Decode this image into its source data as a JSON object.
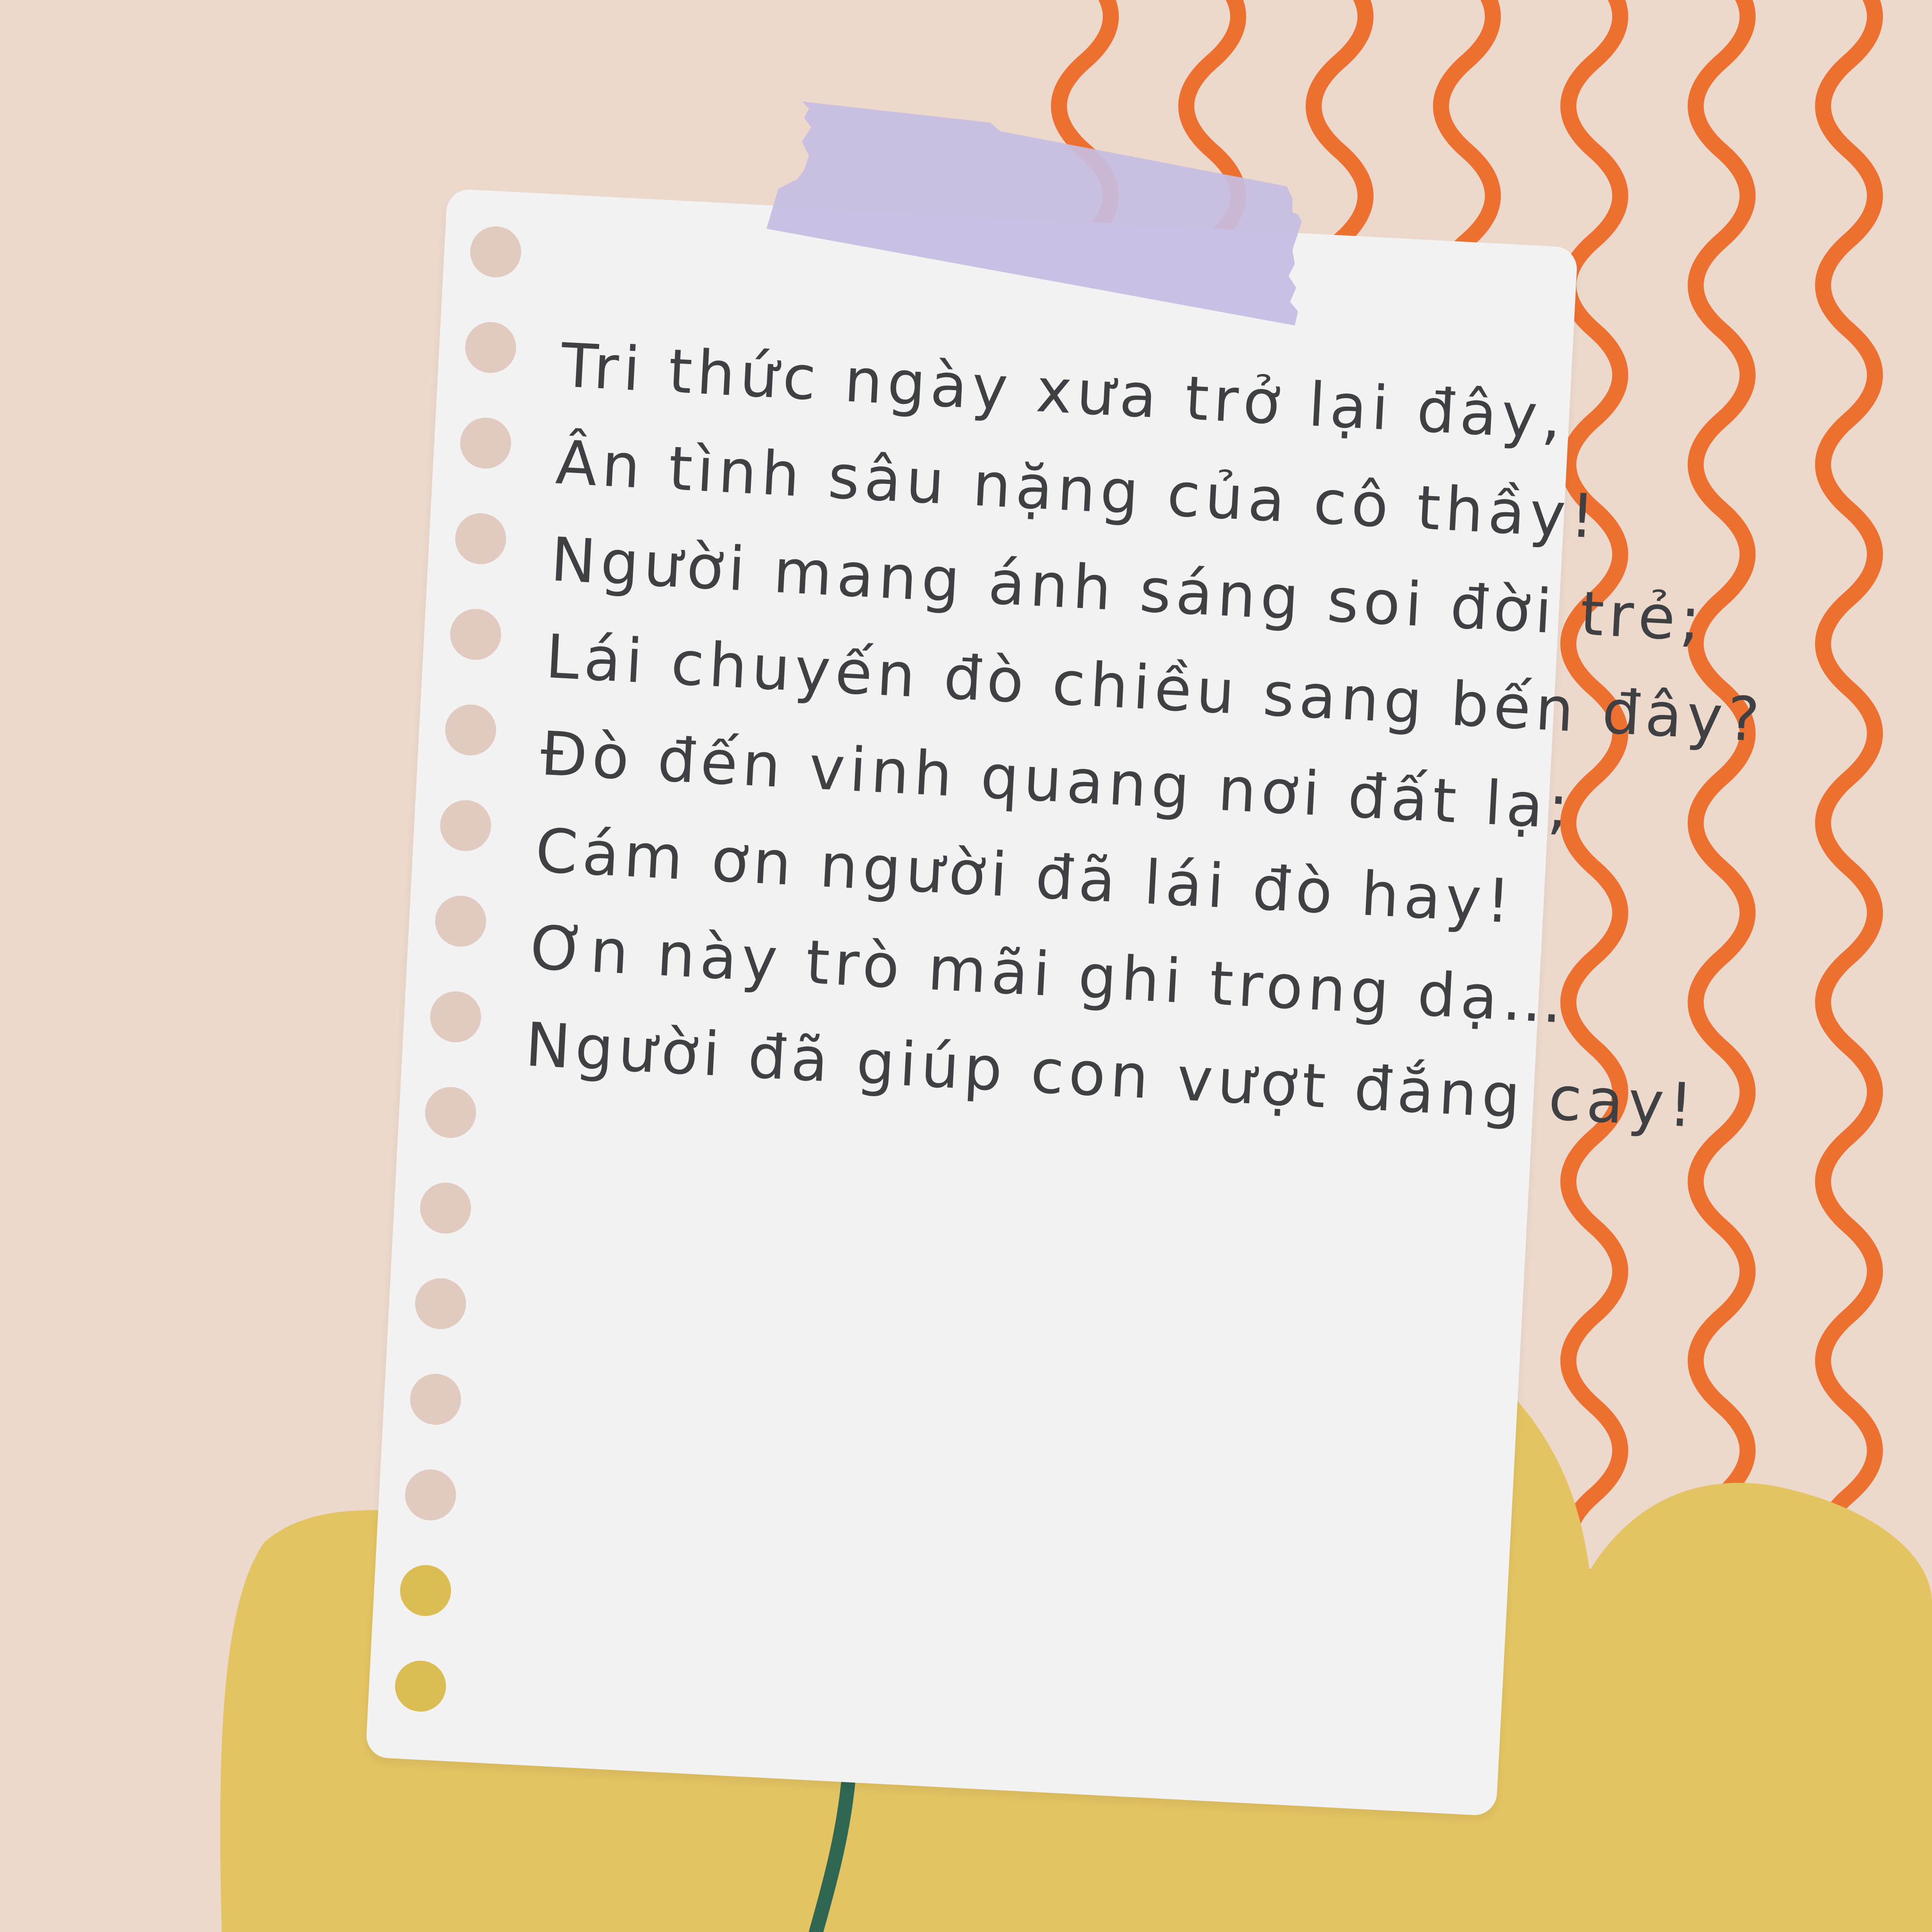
{
  "colors": {
    "background": "#ecd9cb",
    "stripes": "#ee7031",
    "yellow_blob": "#e3c362",
    "stem": "#2f6753",
    "paper": "#f2f2f2",
    "tape": "#c5bde2",
    "hole_pink": "#e1cbc0",
    "hole_yellow": "#dcbd54",
    "text": "#3f4044"
  },
  "poem": {
    "lines": [
      "Tri thức ngày xưa trở lại đây,",
      "Ân tình sâu nặng của cô thầy!",
      "Người mang ánh sáng soi đời trẻ;",
      "Lái chuyến đò chiều sang bến đây?",
      "Đò đến vinh quang nơi đất lạ;",
      "Cám ơn người đã lái đò hay!",
      "Ơn này trò mãi ghi trong dạ…",
      "Người đã giúp con vượt đắng cay!"
    ]
  },
  "decorations": {
    "hole_count": 16,
    "yellow_holes": 2,
    "stripe_count": 7,
    "tape_icon": "washi-tape",
    "leaf_icon": "leaf"
  }
}
